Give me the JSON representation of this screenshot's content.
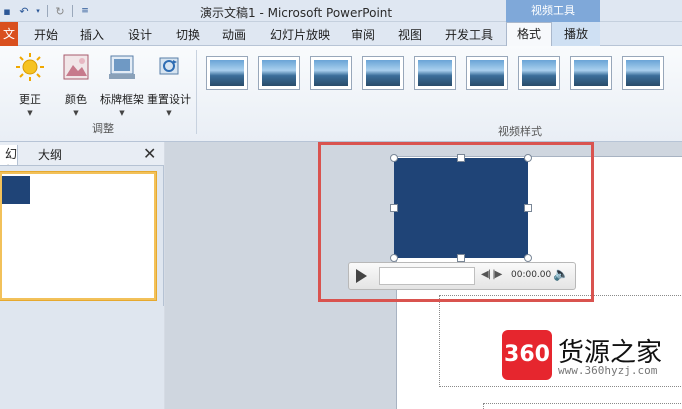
{
  "window": {
    "title": "演示文稿1 - Microsoft PowerPoint",
    "context_tab_group": "视频工具"
  },
  "quick_access": {
    "items": [
      "save-icon",
      "undo-icon",
      "redo-icon",
      "customize-icon"
    ]
  },
  "tabs": {
    "file": "文件",
    "items": [
      {
        "label": "开始"
      },
      {
        "label": "插入"
      },
      {
        "label": "设计"
      },
      {
        "label": "切换"
      },
      {
        "label": "动画"
      },
      {
        "label": "幻灯片放映"
      },
      {
        "label": "审阅"
      },
      {
        "label": "视图"
      },
      {
        "label": "开发工具"
      }
    ],
    "format": "格式",
    "playback": "播放"
  },
  "ribbon": {
    "adjust": {
      "group_label": "调整",
      "buttons": [
        {
          "label": "更正",
          "icon": "sun-icon"
        },
        {
          "label": "颜色",
          "icon": "color-icon"
        },
        {
          "label": "标牌框架",
          "icon": "poster-frame-icon"
        },
        {
          "label": "重置设计",
          "icon": "reset-design-icon"
        }
      ]
    },
    "video_styles": {
      "group_label": "视频样式",
      "thumbnail_count": 9
    }
  },
  "left_pane": {
    "tab_slides": "幻灯片",
    "tab_outline": "大纲",
    "close_glyph": "✕"
  },
  "video": {
    "fill_color": "#1f4477",
    "time": "00:00.00"
  },
  "watermark": {
    "badge": "360",
    "name": "货源之家",
    "url": "www.360hyzj.com"
  },
  "colors": {
    "accent_red": "#d9534f",
    "file_tab": "#d9501f",
    "context_tab": "#7fa8d9"
  }
}
